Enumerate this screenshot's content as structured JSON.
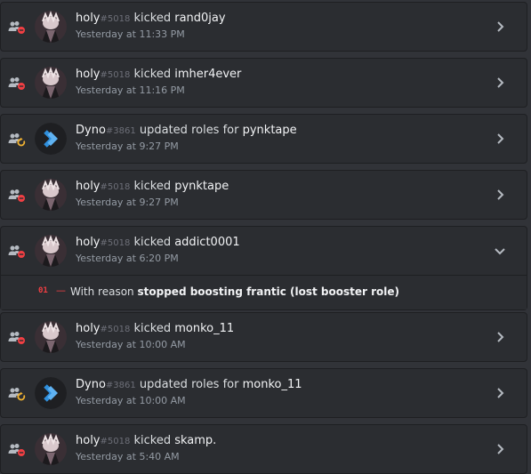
{
  "entries": [
    {
      "user": "holy",
      "discriminator": "#5018",
      "verb": "kicked",
      "target": "rand0jay",
      "time": "Yesterday at 11:33 PM",
      "type": "kick",
      "avatar": "holy-avatar"
    },
    {
      "user": "holy",
      "discriminator": "#5018",
      "verb": "kicked",
      "target": "imher4ever",
      "time": "Yesterday at 11:16 PM",
      "type": "kick",
      "avatar": "holy-avatar"
    },
    {
      "user": "Dyno",
      "discriminator": "#3861",
      "verb": "updated roles for",
      "target": "pynktape",
      "time": "Yesterday at 9:27 PM",
      "type": "role",
      "avatar": "dyno-avatar"
    },
    {
      "user": "holy",
      "discriminator": "#5018",
      "verb": "kicked",
      "target": "pynktape",
      "time": "Yesterday at 9:27 PM",
      "type": "kick",
      "avatar": "holy-avatar"
    },
    {
      "user": "holy",
      "discriminator": "#5018",
      "verb": "kicked",
      "target": "addict0001",
      "time": "Yesterday at 6:20 PM",
      "type": "kick",
      "avatar": "holy-avatar",
      "expanded": true,
      "detail": {
        "number": "01",
        "dash": "—",
        "prefix": "With reason",
        "reason": "stopped boosting frantic (lost booster role)"
      }
    },
    {
      "user": "holy",
      "discriminator": "#5018",
      "verb": "kicked",
      "target": "monko_11",
      "time": "Yesterday at 10:00 AM",
      "type": "kick",
      "avatar": "holy-avatar"
    },
    {
      "user": "Dyno",
      "discriminator": "#3861",
      "verb": "updated roles for",
      "target": "monko_11",
      "time": "Yesterday at 10:00 AM",
      "type": "role",
      "avatar": "dyno-avatar"
    },
    {
      "user": "holy",
      "discriminator": "#5018",
      "verb": "kicked",
      "target": "skamp.",
      "time": "Yesterday at 5:40 AM",
      "type": "kick",
      "avatar": "holy-avatar"
    }
  ],
  "icons": {
    "kick": "member-kick-icon",
    "role": "member-role-update-icon",
    "collapsed": "chevron-right-icon",
    "expanded": "chevron-down-icon"
  },
  "colors": {
    "kick_badge": "#f23f43",
    "role_badge": "#f0b232",
    "dyno_blue": "#2f8fdc"
  }
}
